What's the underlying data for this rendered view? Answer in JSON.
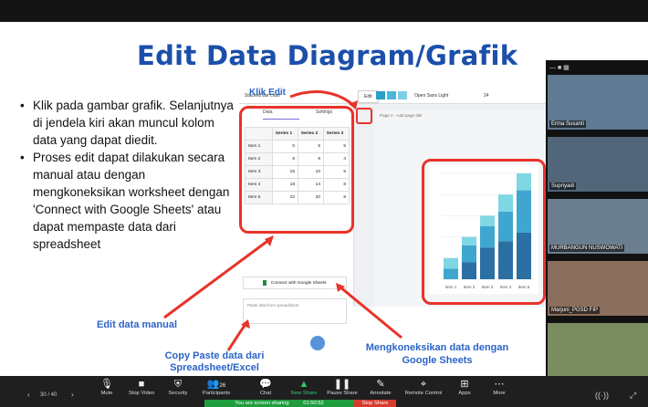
{
  "slide": {
    "title": "Edit Data Diagram/Grafik",
    "bullets": [
      "Klik pada gambar grafik. Selanjutnya di jendela kiri akan muncul kolom data yang dapat diedit.",
      "Proses edit dapat dilakukan secara manual atau dengan mengkoneksikan worksheet dengan 'Connect with Google Sheets' atau dapat mempaste data dari spreadsheet"
    ],
    "annotations": {
      "klik_edit": "Klik Edit",
      "edit_manual": "Edit data manual",
      "copy_paste": "Copy Paste data dari Spreadsheet/Excel",
      "connect": "Mengkoneksikan data dengan Google Sheets"
    }
  },
  "editor": {
    "chart_type": "Stacked bar chart",
    "edit_button": "Edit",
    "font": "Open Sans Light",
    "font_size": "24",
    "tab_data": "Data",
    "tab_settings": "Settings",
    "page_label": "Page 2 - Add page title",
    "connect_button": "Connect with Google Sheets",
    "paste_placeholder": "Paste data from spreadsheet",
    "table": {
      "headers": [
        "",
        "Series 1",
        "Series 2",
        "Series 3"
      ],
      "rows": [
        [
          "Item 1",
          "0",
          "5",
          "5"
        ],
        [
          "Item 2",
          "8",
          "8",
          "4"
        ],
        [
          "Item 3",
          "15",
          "10",
          "5"
        ],
        [
          "Item 4",
          "18",
          "14",
          "8"
        ],
        [
          "Item 5",
          "22",
          "20",
          "8"
        ]
      ]
    }
  },
  "chart_data": {
    "type": "bar",
    "stacked": true,
    "categories": [
      "Item 1",
      "Item 2",
      "Item 3",
      "Item 4",
      "Item 5"
    ],
    "series": [
      {
        "values": [
          0,
          8,
          15,
          18,
          22
        ],
        "color": "#2b6fa3"
      },
      {
        "values": [
          5,
          8,
          10,
          14,
          20
        ],
        "color": "#3fa6cf"
      },
      {
        "values": [
          5,
          4,
          5,
          8,
          8
        ],
        "color": "#7fd7e4"
      }
    ],
    "ylim": [
      0,
      50
    ]
  },
  "participants": [
    {
      "name": "Erma Susanti"
    },
    {
      "name": "Supriyadi"
    },
    {
      "name": "MURBANGUN NUSWOWATI"
    },
    {
      "name": "Marjuni_PGSD FIP"
    }
  ],
  "zoom": {
    "page": "30 / 40",
    "buttons": [
      {
        "label": "Mute",
        "icon": "mic-icon"
      },
      {
        "label": "Stop Video",
        "icon": "video-icon"
      },
      {
        "label": "Security",
        "icon": "shield-icon"
      },
      {
        "label": "Participants",
        "icon": "participants-icon",
        "count": "26"
      },
      {
        "label": "Chat",
        "icon": "chat-icon"
      },
      {
        "label": "New Share",
        "icon": "share-icon"
      },
      {
        "label": "Pause Share",
        "icon": "pause-icon"
      },
      {
        "label": "Annotate",
        "icon": "pen-icon"
      },
      {
        "label": "Remote Control",
        "icon": "remote-icon"
      },
      {
        "label": "Apps",
        "icon": "apps-icon"
      },
      {
        "label": "More",
        "icon": "more-icon"
      }
    ],
    "sharing_text": "You are screen sharing",
    "timer": "01:50:52",
    "stop_share": "Stop Share"
  }
}
